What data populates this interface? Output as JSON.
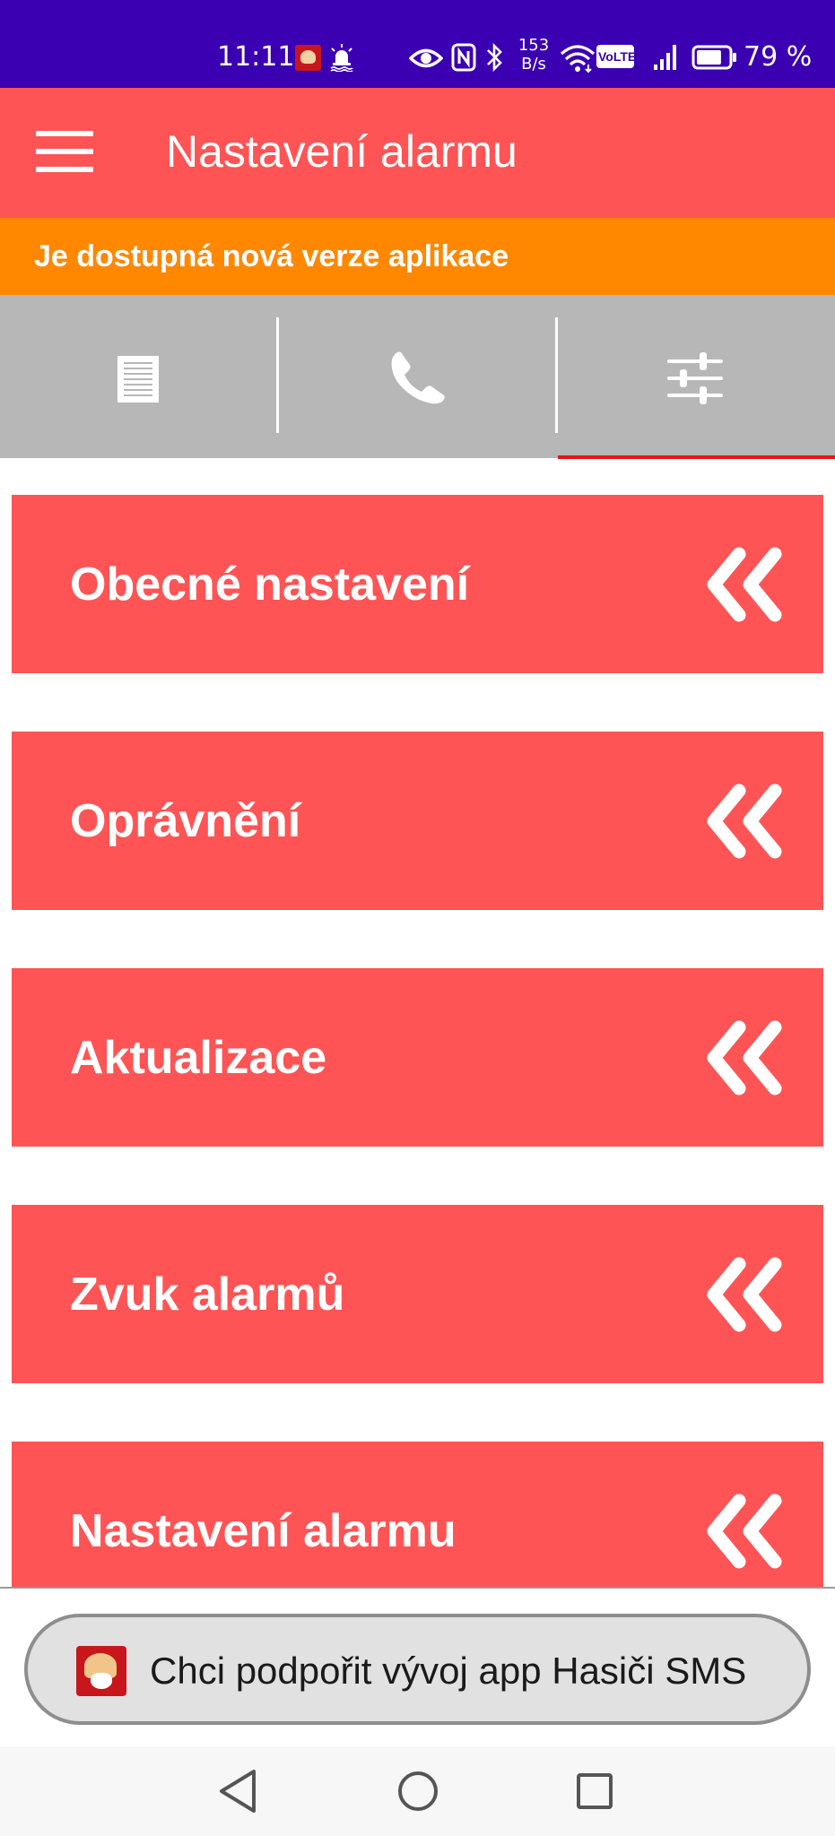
{
  "status_bar": {
    "time": "11:11",
    "net_speed_value": "153",
    "net_speed_unit": "B/s",
    "volte_label": "VoLTE",
    "battery_percent": "79 %",
    "battery_level": 0.79,
    "icons": [
      "hasici-app-icon",
      "alarm-light-icon",
      "eye-icon",
      "nfc-icon",
      "bluetooth-icon",
      "wifi-icon",
      "volte-icon",
      "signal-icon",
      "battery-icon"
    ]
  },
  "app_bar": {
    "title": "Nastavení alarmu",
    "menu_icon": "hamburger-menu-icon"
  },
  "update_banner": {
    "text": "Je dostupná nová verze aplikace"
  },
  "tabs": {
    "items": [
      {
        "icon": "document-list-icon",
        "selected": false
      },
      {
        "icon": "phone-icon",
        "selected": false
      },
      {
        "icon": "sliders-icon",
        "selected": true
      }
    ]
  },
  "settings": {
    "items": [
      {
        "label": "Obecné nastavení"
      },
      {
        "label": "Oprávnění"
      },
      {
        "label": "Aktualizace"
      },
      {
        "label": "Zvuk alarmů"
      },
      {
        "label": "Nastavení alarmu"
      }
    ],
    "expand_icon": "double-chevron-left-icon"
  },
  "support": {
    "label": "Chci podpořit vývoj app Hasiči SMS",
    "icon": "firefighter-app-icon"
  },
  "nav_bar": {
    "buttons": [
      "back-triangle-icon",
      "home-circle-icon",
      "recents-square-icon"
    ]
  },
  "colors": {
    "status_bar": "#3a00b2",
    "primary": "#ff5455",
    "banner": "#ff8800",
    "tab_strip": "#b7b7b7",
    "tab_indicator": "#e4141a",
    "support_button": "#e1e1e1"
  }
}
